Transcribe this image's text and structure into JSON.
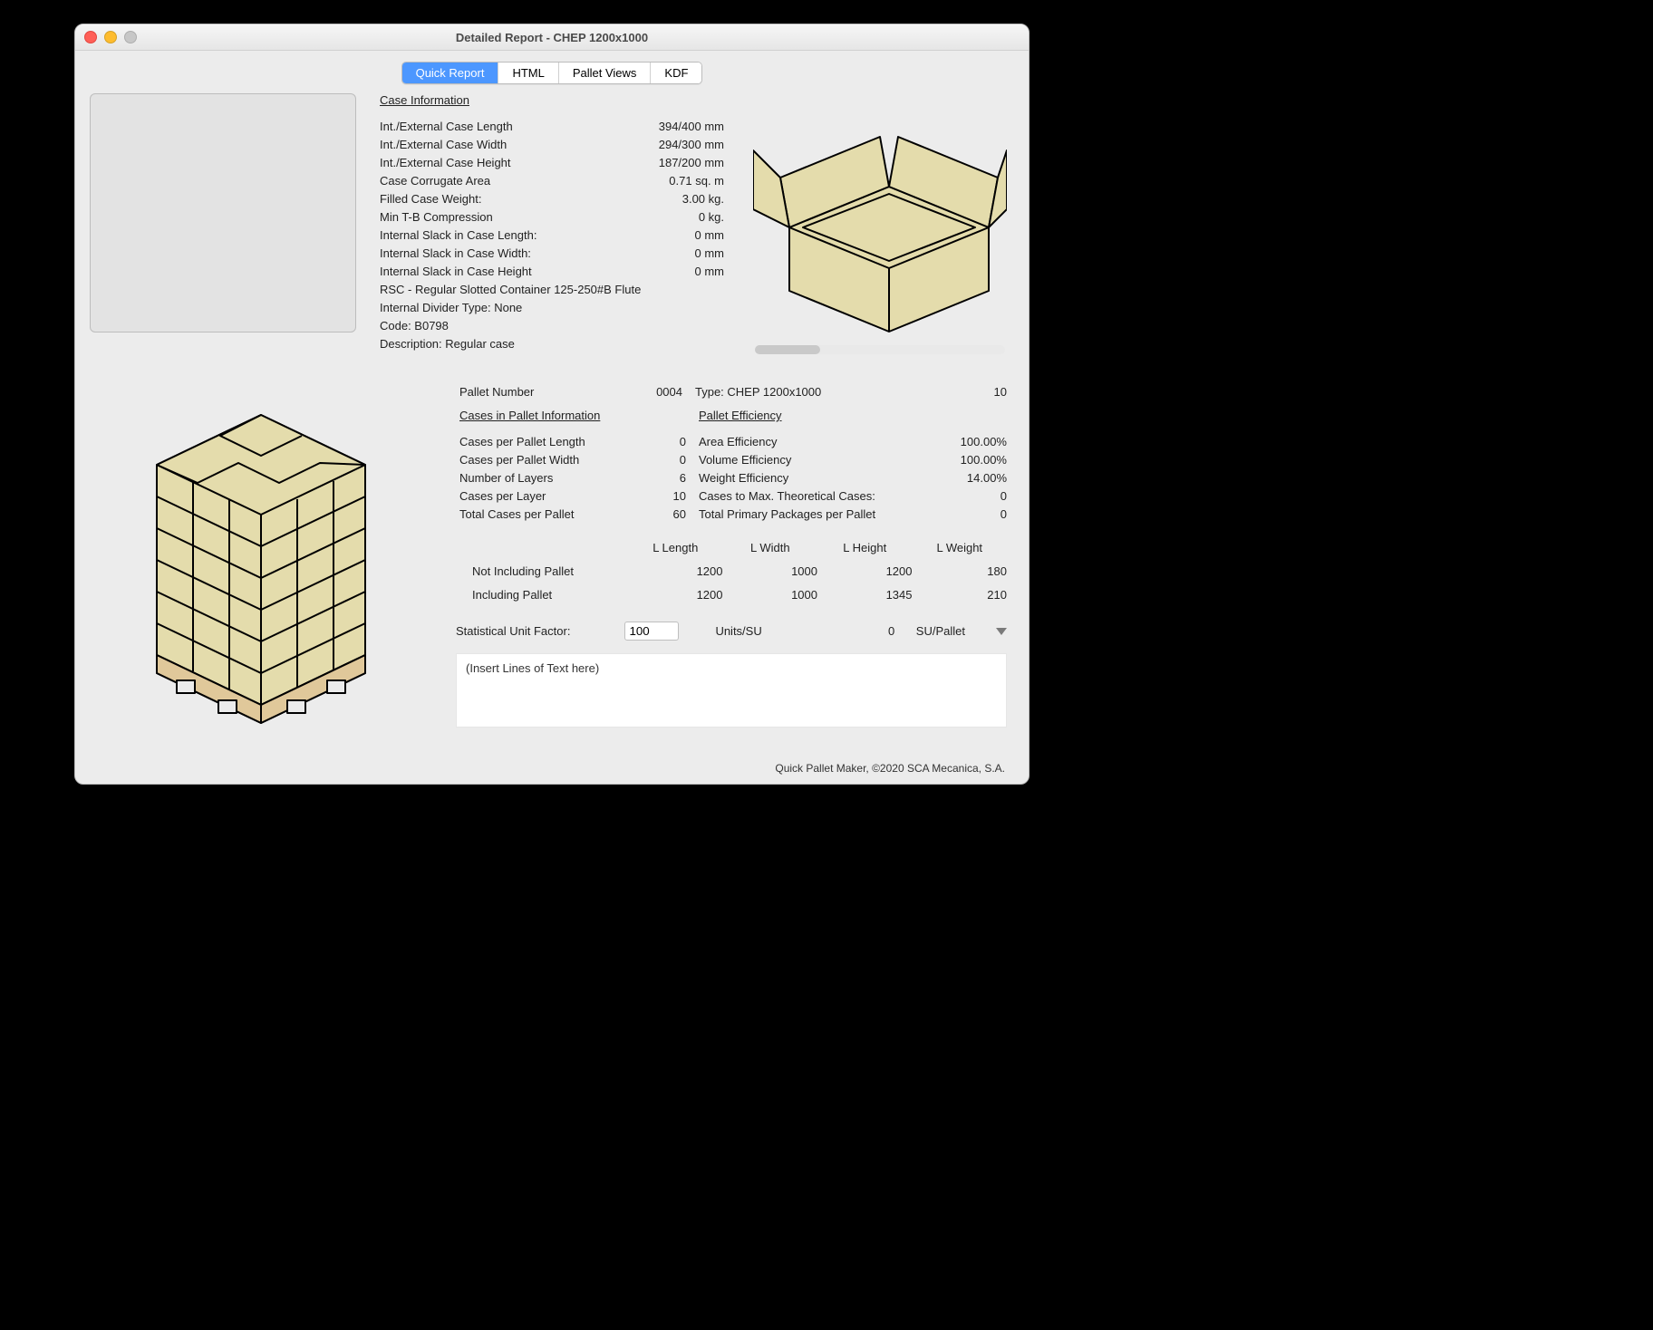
{
  "window": {
    "title": "Detailed Report - CHEP 1200x1000"
  },
  "tabs": {
    "quick": "Quick Report",
    "html": "HTML",
    "views": "Pallet Views",
    "kdf": "KDF"
  },
  "case": {
    "title": "Case Information",
    "rows": {
      "len": {
        "l": "Int./External Case Length",
        "v": "394/400 mm"
      },
      "wid": {
        "l": "Int./External Case Width",
        "v": "294/300 mm"
      },
      "hgt": {
        "l": "Int./External Case Height",
        "v": "187/200 mm"
      },
      "area": {
        "l": "Case Corrugate Area",
        "v": "0.71 sq. m"
      },
      "wgt": {
        "l": "Filled Case Weight:",
        "v": "3.00 kg."
      },
      "comp": {
        "l": "Min T-B Compression",
        "v": "0 kg."
      },
      "sl": {
        "l": "Internal Slack in Case Length:",
        "v": "0 mm"
      },
      "sw": {
        "l": "Internal Slack in Case Width:",
        "v": "0 mm"
      },
      "sh": {
        "l": "Internal Slack in Case Height",
        "v": "0 mm"
      }
    },
    "plain": {
      "rsc": "RSC - Regular Slotted Container 125-250#B Flute",
      "div": "Internal Divider Type: None",
      "code": "Code: B0798",
      "desc": "Description: Regular case"
    }
  },
  "pallet": {
    "numLabel": "Pallet Number",
    "num": "0004",
    "typeLabel": "Type: CHEP 1200x1000",
    "typeVal": "10",
    "leftTitle": "Cases in Pallet Information",
    "rightTitle": "Pallet Efficiency",
    "left": {
      "cpl": {
        "l": "Cases per Pallet Length",
        "v": "0"
      },
      "cpw": {
        "l": "Cases per Pallet Width",
        "v": "0"
      },
      "lay": {
        "l": "Number of Layers",
        "v": "6"
      },
      "cly": {
        "l": "Cases per Layer",
        "v": "10"
      },
      "tot": {
        "l": "Total Cases per Pallet",
        "v": "60"
      }
    },
    "right": {
      "ae": {
        "l": "Area Efficiency",
        "v": "100.00%"
      },
      "ve": {
        "l": "Volume Efficiency",
        "v": "100.00%"
      },
      "we": {
        "l": "Weight Efficiency",
        "v": "14.00%"
      },
      "mc": {
        "l": "Cases to Max. Theoretical Cases:",
        "v": "0"
      },
      "pp": {
        "l": "Total Primary Packages per Pallet",
        "v": "0"
      }
    }
  },
  "ltable": {
    "h1": "L Length",
    "h2": "L Width",
    "h3": "L Height",
    "h4": "L Weight",
    "r1": {
      "l": "Not Including Pallet",
      "a": "1200",
      "b": "1000",
      "c": "1200",
      "d": "180"
    },
    "r2": {
      "l": "Including Pallet",
      "a": "1200",
      "b": "1000",
      "c": "1345",
      "d": "210"
    }
  },
  "stat": {
    "label": "Statistical Unit Factor:",
    "value": "100",
    "unitsLabel": "Units/SU",
    "suVal": "0",
    "suLabel": "SU/Pallet"
  },
  "textarea": {
    "placeholder": "(Insert Lines of Text here)"
  },
  "footer": "Quick Pallet Maker, ©2020 SCA Mecanica, S.A."
}
